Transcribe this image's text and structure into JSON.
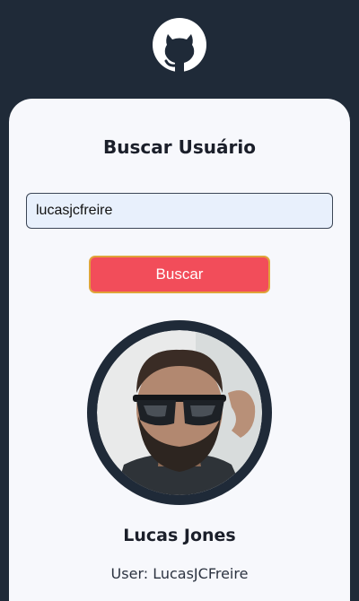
{
  "header": {
    "logo_icon": "github-icon"
  },
  "search": {
    "title": "Buscar Usuário",
    "input_value": "lucasjcfreire",
    "button_label": "Buscar"
  },
  "profile": {
    "avatar_icon": "user-avatar",
    "name": "Lucas Jones",
    "username": "User: LucasJCFreire"
  },
  "colors": {
    "background": "#1f2a38",
    "card": "#f7f8fc",
    "button": "#f24d5a",
    "button_border": "#e0a43a",
    "input_bg": "#e8f0fc"
  }
}
